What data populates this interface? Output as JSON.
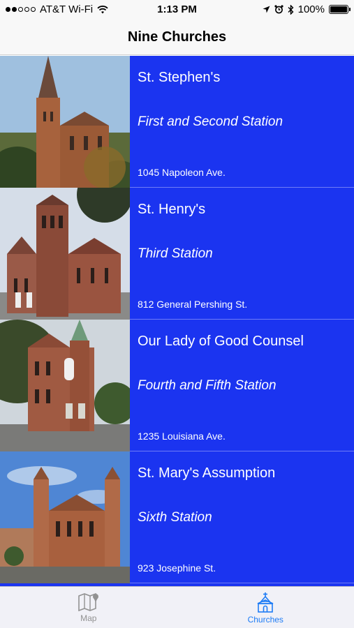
{
  "status_bar": {
    "carrier": "AT&T Wi-Fi",
    "time": "1:13 PM",
    "battery": "100%",
    "battery_level": 1.0,
    "icons": [
      "signal-dots-icon",
      "wifi-icon",
      "location-arrow-icon",
      "alarm-icon",
      "bluetooth-icon",
      "battery-icon"
    ]
  },
  "nav": {
    "title": "Nine Churches"
  },
  "churches": [
    {
      "name": "St. Stephen's",
      "station": "First and Second Station",
      "address": "1045 Napoleon Ave."
    },
    {
      "name": "St. Henry's",
      "station": "Third Station",
      "address": "812 General Pershing St."
    },
    {
      "name": "Our Lady of Good Counsel",
      "station": "Fourth and Fifth Station",
      "address": "1235 Louisiana Ave."
    },
    {
      "name": "St. Mary's Assumption",
      "station": "Sixth Station",
      "address": "923 Josephine St."
    }
  ],
  "tabs": [
    {
      "label": "Map",
      "icon": "map-icon",
      "active": false
    },
    {
      "label": "Churches",
      "icon": "church-icon",
      "active": true
    }
  ],
  "colors": {
    "list_background": "#1b34f0",
    "active_tab": "#1e7cf5",
    "inactive_tab": "#929292"
  }
}
